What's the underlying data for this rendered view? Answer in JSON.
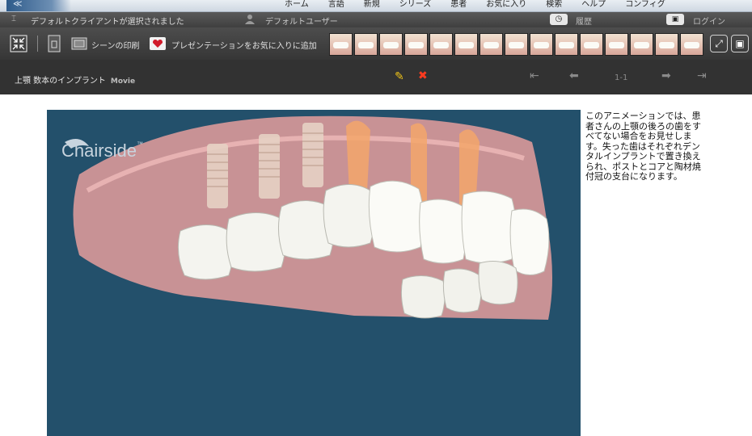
{
  "topnav": {
    "logo_text": "≪",
    "menu": [
      "ホーム",
      "言語",
      "新規",
      "シリーズ",
      "患者",
      "お気に入り",
      "検索",
      "ヘルプ",
      "コンフィグ"
    ]
  },
  "statusbar": {
    "client_message": "デフォルトクライアントが選択されました",
    "user": "デフォルトユーザー",
    "history": "履歴",
    "login": "ログイン"
  },
  "toolbar": {
    "print_label": "シーンの印刷",
    "favorite_label": "プレゼンテーションをお気に入りに追加",
    "thumbnail_count": 15
  },
  "header": {
    "title": "上顎 数本のインプラント",
    "type_label": "Movie",
    "page": "1-1"
  },
  "viewer": {
    "brand": "Chairside",
    "brand_mark": "™"
  },
  "description": "このアニメーションでは、患者さんの上顎の後ろの歯をすべてない場合をお見せします。失った歯はそれぞれデンタルインプラントで置き換えられ、ポストとコアと陶材焼付冠の支台になります。",
  "colors": {
    "viewer_bg": "#23506b",
    "header_bg": "#323232",
    "accent_close": "#ff3b1f",
    "accent_edit": "#f0c419"
  }
}
